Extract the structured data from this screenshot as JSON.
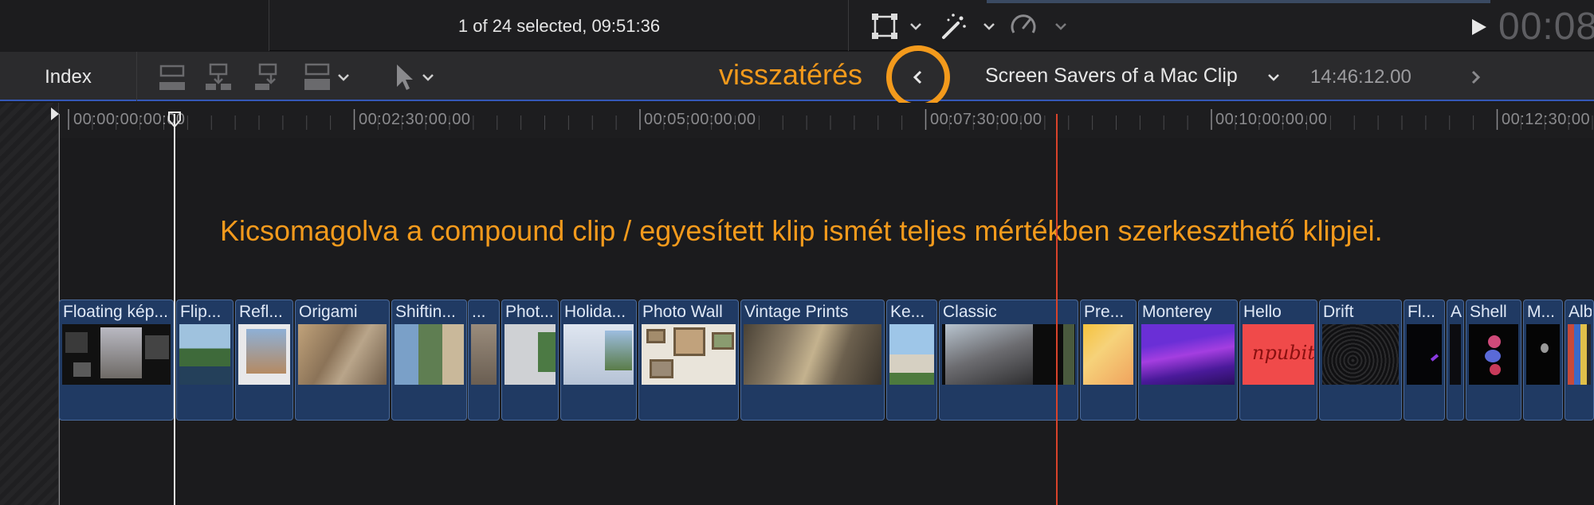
{
  "viewer": {
    "selection_status": "1 of 24 selected, 09:51:36",
    "timecode": "00:08"
  },
  "toolbar": {
    "index_label": "Index",
    "back_annotation": "visszatérés",
    "clip_name": "Screen Savers of a Mac Clip",
    "clip_duration": "14:46:12.00"
  },
  "timeline": {
    "annotation": "Kicsomagolva a compound clip / egyesített klip ismét teljes mértékben szerkeszthető klipjei.",
    "ruler_labels": [
      "00:00:00:00:00",
      "00:02:30:00.00",
      "00:05:00:00.00",
      "00:07:30:00.00",
      "00:10:00:00.00",
      "00:12:30:00"
    ],
    "clips": [
      "Floating kép...",
      "Flip...",
      "Refl...",
      "Origami",
      "Shiftin...",
      "...",
      "Phot...",
      "Holida...",
      "Photo Wall",
      "Vintage Prints",
      "Ke...",
      "Classic",
      "Pre...",
      "Monterey",
      "Hello",
      "Drift",
      "Fl...",
      "A",
      "Shell",
      "M...",
      "Albu"
    ],
    "hello_thumb_text": "npubit"
  },
  "colors": {
    "accent_orange": "#f39a1c",
    "clip_blue": "#203a63",
    "playhead_red": "#d9432b",
    "selection_blue": "#3558b8"
  }
}
